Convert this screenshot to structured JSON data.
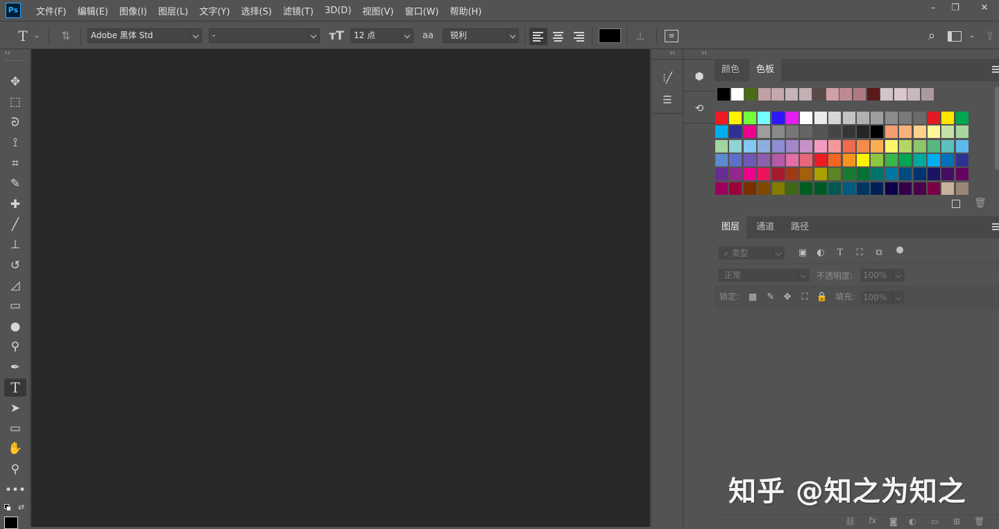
{
  "app": {
    "logo": "Ps"
  },
  "menu": [
    "文件(F)",
    "编辑(E)",
    "图像(I)",
    "图层(L)",
    "文字(Y)",
    "选择(S)",
    "滤镜(T)",
    "3D(D)",
    "视图(V)",
    "窗口(W)",
    "帮助(H)"
  ],
  "window_controls": {
    "minimize": "–",
    "restore": "❐",
    "close": "✕"
  },
  "options_bar": {
    "tool_icon": "T",
    "font_family": "Adobe 黑体 Std",
    "font_style": "-",
    "font_size": "12 点",
    "antialias_icon": "aa",
    "antialias": "锐利",
    "text_color": "#000000"
  },
  "toolbox": [
    {
      "name": "move-tool-icon",
      "glyph": "✥"
    },
    {
      "name": "marquee-tool-icon",
      "glyph": "⬚"
    },
    {
      "name": "lasso-tool-icon",
      "glyph": "ᘐ"
    },
    {
      "name": "quick-select-tool-icon",
      "glyph": "⟟"
    },
    {
      "name": "crop-tool-icon",
      "glyph": "⌗"
    },
    {
      "name": "eyedropper-tool-icon",
      "glyph": "✎"
    },
    {
      "name": "healing-brush-tool-icon",
      "glyph": "✚"
    },
    {
      "name": "brush-tool-icon",
      "glyph": "╱"
    },
    {
      "name": "clone-stamp-tool-icon",
      "glyph": "⊥"
    },
    {
      "name": "history-brush-tool-icon",
      "glyph": "↺"
    },
    {
      "name": "eraser-tool-icon",
      "glyph": "◿"
    },
    {
      "name": "gradient-tool-icon",
      "glyph": "▭"
    },
    {
      "name": "blur-tool-icon",
      "glyph": "●"
    },
    {
      "name": "dodge-tool-icon",
      "glyph": "⚲"
    },
    {
      "name": "pen-tool-icon",
      "glyph": "✒"
    },
    {
      "name": "type-tool-icon",
      "glyph": "T"
    },
    {
      "name": "path-select-tool-icon",
      "glyph": "➤"
    },
    {
      "name": "rectangle-tool-icon",
      "glyph": "▭"
    },
    {
      "name": "hand-tool-icon",
      "glyph": "✋"
    },
    {
      "name": "zoom-tool-icon",
      "glyph": "⚲"
    },
    {
      "name": "more-tools-icon",
      "glyph": "•••"
    }
  ],
  "swatches_panel": {
    "tabs": [
      "颜色",
      "色板"
    ],
    "recent": [
      "#000000",
      "#ffffff",
      "#4d6a18",
      "#c0a0a6",
      "#c4a8ae",
      "#c8b4b8",
      "#c2b0b4",
      "#5a4a4a",
      "#d0a0a6",
      "#c08a92",
      "#b07a82",
      "#5a1a1a",
      "#d4c4c8",
      "#d8c8cc",
      "#c8b8bc",
      "#ac9a9e"
    ],
    "grid": [
      [
        "#ed1c24",
        "#fff200",
        "#74ff3c",
        "#73fbfd",
        "#2e17ff",
        "#e61df2",
        "#ffffff",
        "#ebebeb",
        "#d6d6d6",
        "#c2c2c2",
        "#b0b0b0",
        "#9e9e9e",
        "#8c8c8c",
        "#7a7a7a",
        "#6a6a6a",
        "#e01b24",
        "#ffe600",
        "#00a650"
      ],
      [
        "#00aeef",
        "#2e3192",
        "#ec008c",
        "#9d9d9d",
        "#8a8a8a",
        "#777777",
        "#656565",
        "#555555",
        "#454545",
        "#353535",
        "#252525",
        "#000000",
        "#f49d6e",
        "#f7b27b",
        "#fdd28a",
        "#fff799",
        "#c5e1a5",
        "#a8d5a2"
      ],
      [
        "#a4d4a0",
        "#8fd3d3",
        "#86c6f2",
        "#8faee0",
        "#8d8ed3",
        "#a486c8",
        "#c891c5",
        "#f49ac2",
        "#f4989c",
        "#ef6b4c",
        "#f58b4b",
        "#fbad52",
        "#fff56d",
        "#b5d664",
        "#8bc66c",
        "#58b780",
        "#5bc0be",
        "#5db8ec"
      ],
      [
        "#5c8bd0",
        "#5e6fc8",
        "#6f58b6",
        "#8e5fae",
        "#b45aa6",
        "#e46ea6",
        "#e9677d",
        "#ed1c24",
        "#f26522",
        "#f7941d",
        "#fff200",
        "#8dc63f",
        "#39b54a",
        "#00a651",
        "#00a99d",
        "#00aeef",
        "#0072bc",
        "#2e3192"
      ],
      [
        "#662d91",
        "#92278f",
        "#ec008c",
        "#ed145b",
        "#a6192e",
        "#9e3b16",
        "#a36209",
        "#aba000",
        "#598527",
        "#197b30",
        "#007236",
        "#00746b",
        "#0076a3",
        "#004a80",
        "#003471",
        "#1b1464",
        "#440e62",
        "#630460"
      ],
      [
        "#9e005d",
        "#9e0039",
        "#7b2e00",
        "#7d4900",
        "#827b00",
        "#406618",
        "#005e20",
        "#005826",
        "#005952",
        "#005b7f",
        "#003663",
        "#002157",
        "#0d004c",
        "#32004b",
        "#4b0049",
        "#7b0046",
        "#c7b299",
        "#998675"
      ]
    ]
  },
  "layers_panel": {
    "tabs": [
      "图层",
      "通道",
      "路径"
    ],
    "filter_placeholder": "类型",
    "blend_mode": "正常",
    "opacity_label": "不透明度:",
    "opacity_value": "100%",
    "lock_label": "锁定:",
    "fill_label": "填充:",
    "fill_value": "100%"
  },
  "watermark": "知乎 @知之为知之"
}
